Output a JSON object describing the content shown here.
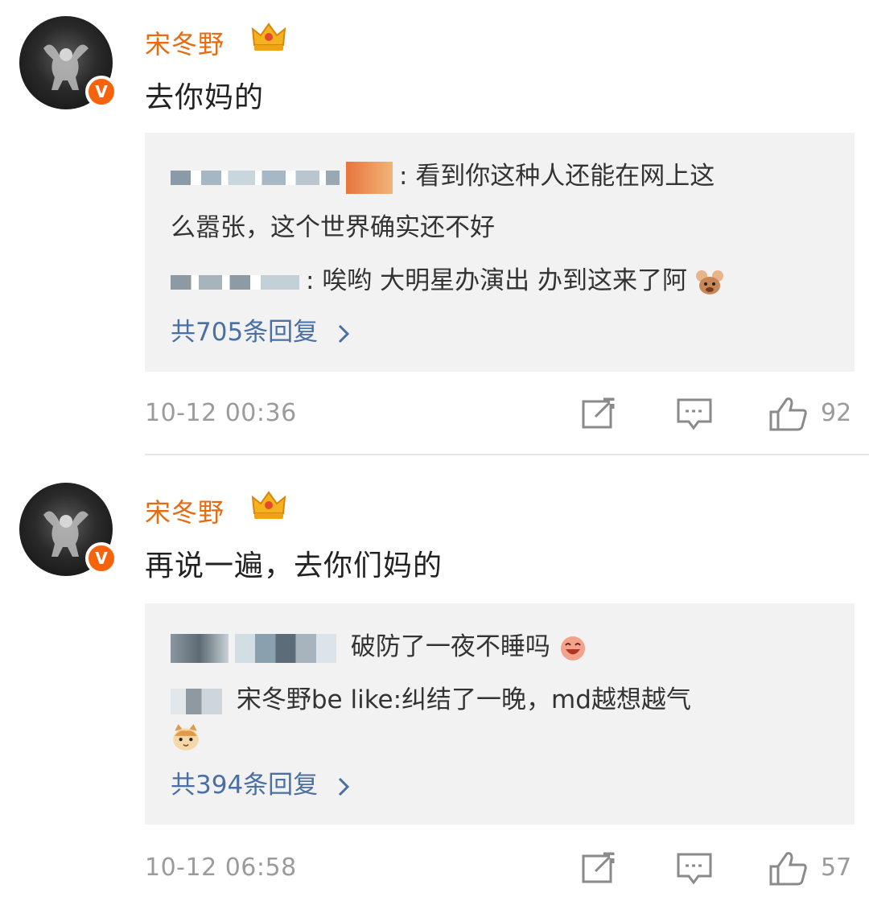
{
  "comments": [
    {
      "username": "宋冬野",
      "content": "去你妈的",
      "replies": [
        {
          "text_line1": "看到你这种人还能在网上这",
          "text_line2": "么嚣张，这个世界确实还不好"
        },
        {
          "text": "唉哟 大明星办演出 办到这来了阿"
        }
      ],
      "total_replies": "共705条回复",
      "timestamp": "10-12 00:36",
      "likes": "92"
    },
    {
      "username": "宋冬野",
      "content": "再说一遍，去你们妈的",
      "replies": [
        {
          "text": "破防了一夜不睡吗"
        },
        {
          "text_line1": "宋冬野be like:纠结了一晚，md越想越气"
        }
      ],
      "total_replies": "共394条回复",
      "timestamp": "10-12 06:58",
      "likes": "57"
    }
  ],
  "icons": {
    "verified": "verified-v-badge",
    "crown": "crown-icon",
    "share": "share-icon",
    "comment": "comment-icon",
    "like": "like-icon",
    "chevron": "chevron-right-icon"
  },
  "badge_letter": "V",
  "colors": {
    "username": "#e86b10",
    "link": "#4a6fa5",
    "meta": "#9b9b9b",
    "reply_bg": "#f2f2f2",
    "verified": "#f7630c"
  }
}
